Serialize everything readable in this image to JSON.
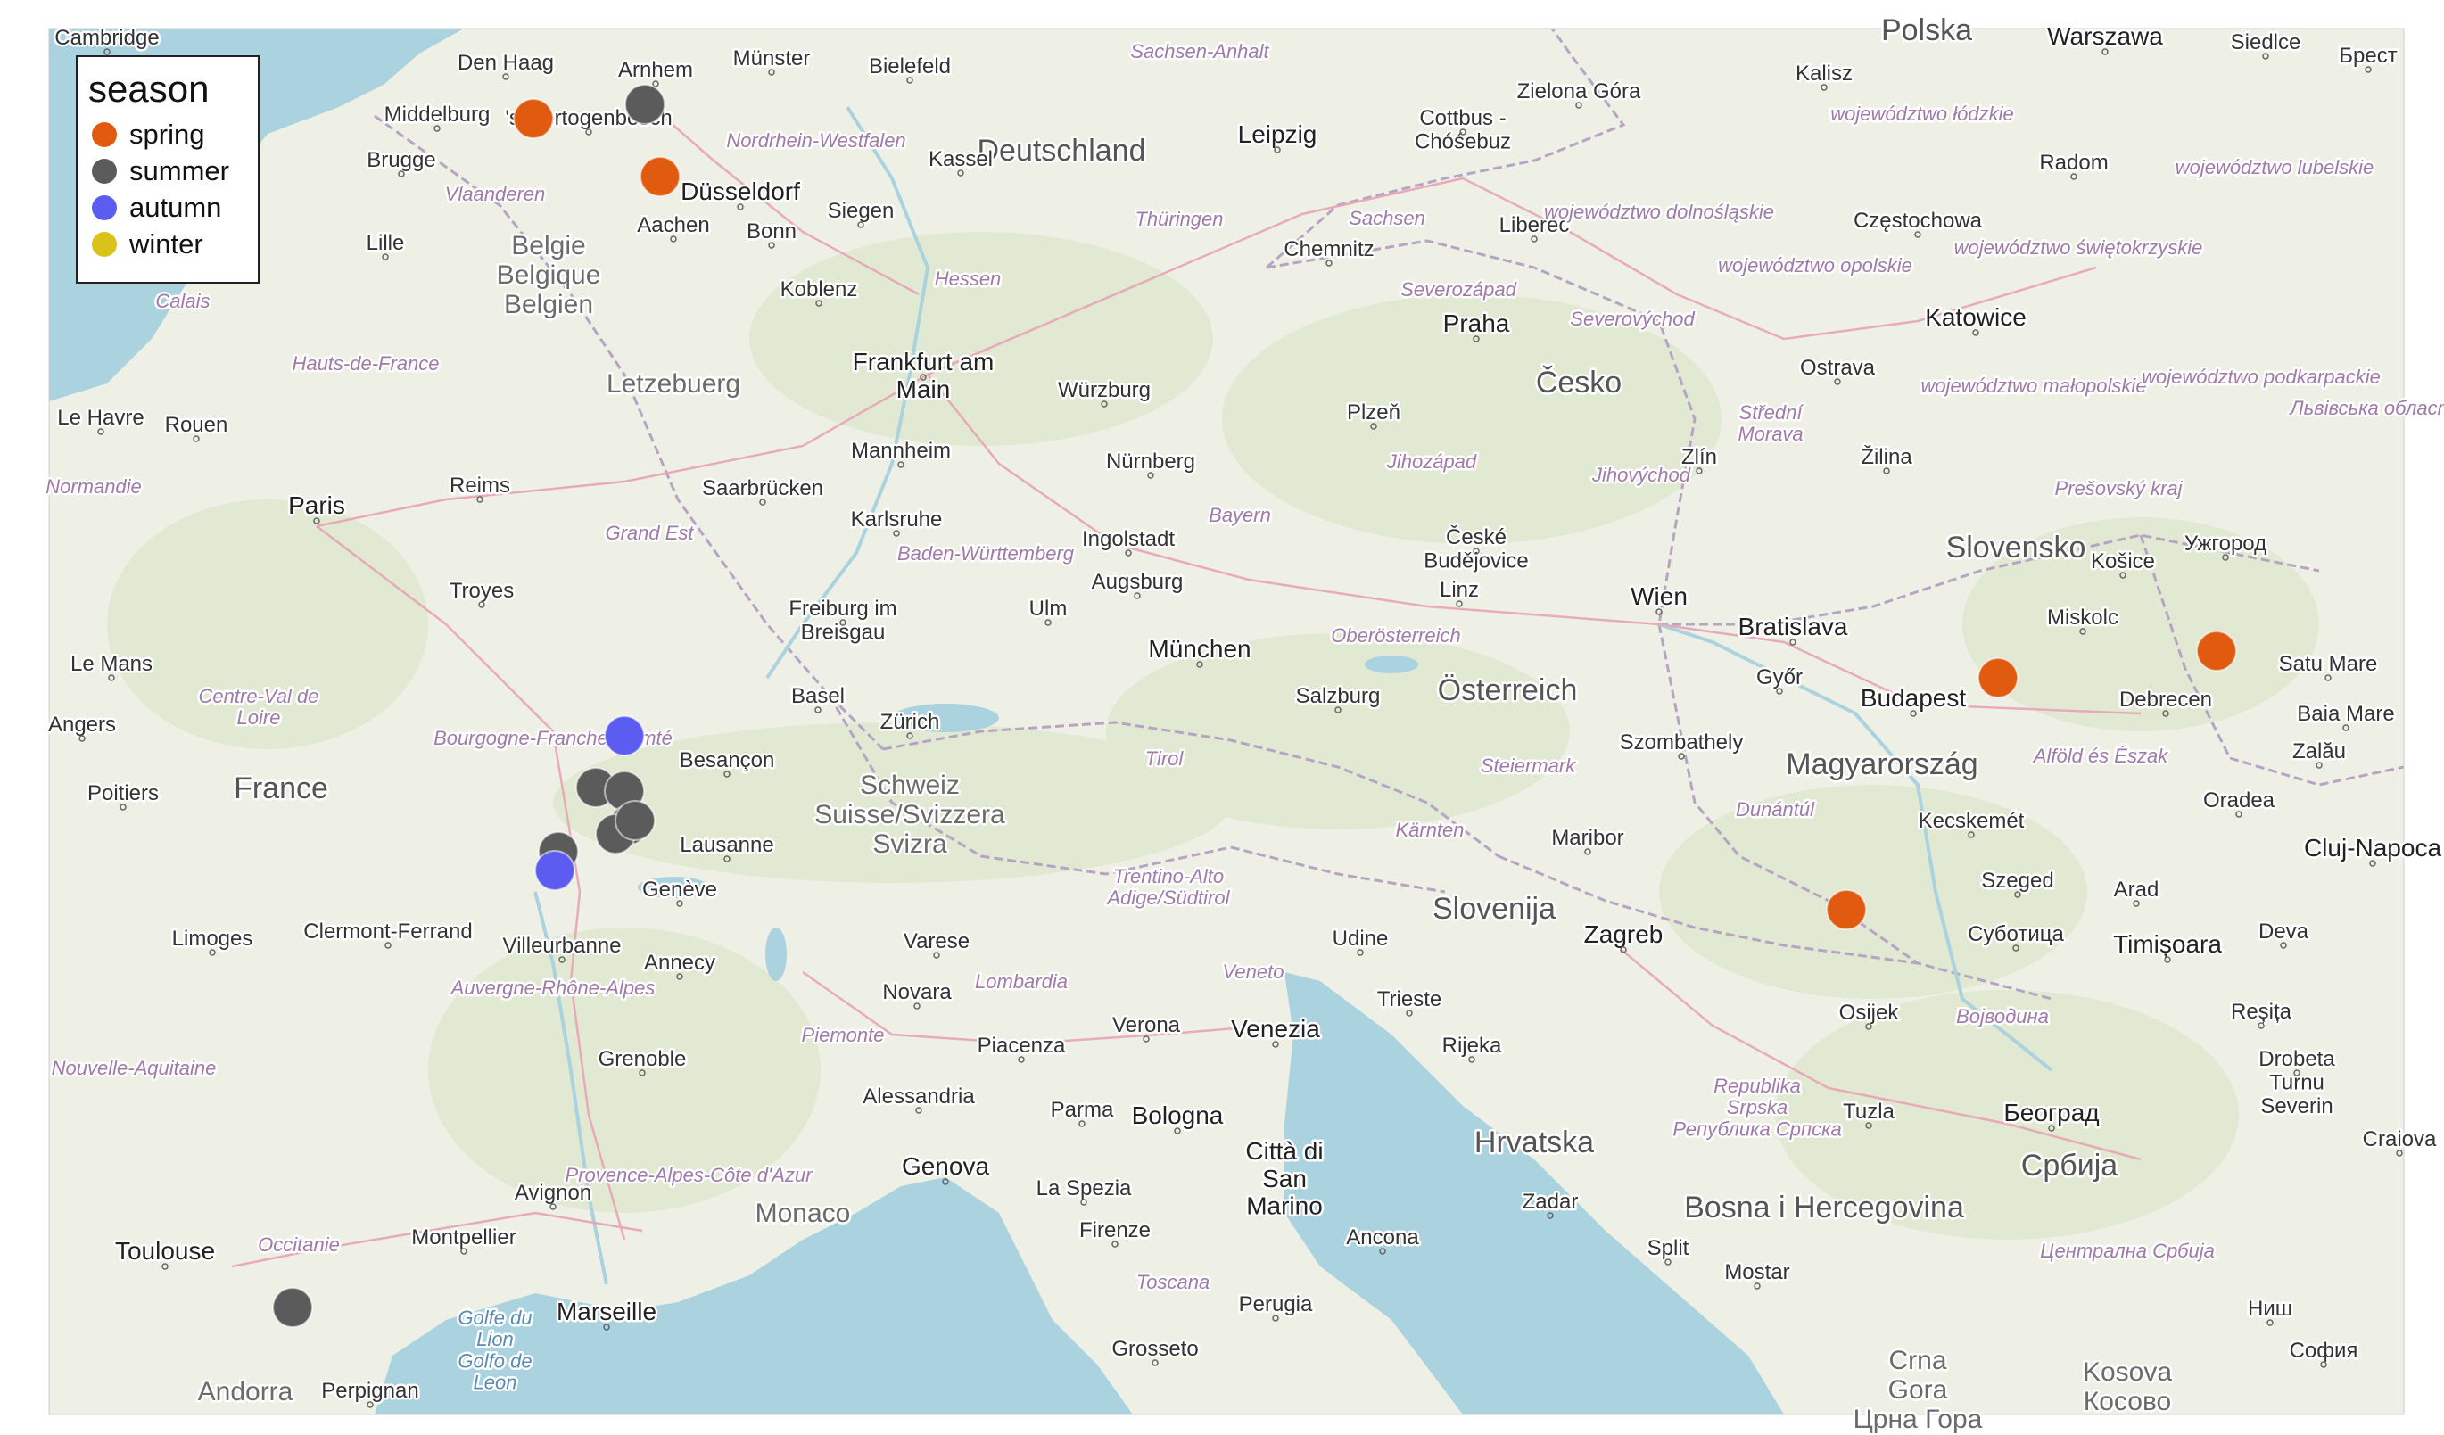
{
  "legend": {
    "title": "season",
    "entries": [
      {
        "label": "spring",
        "color": "#E05A10"
      },
      {
        "label": "summer",
        "color": "#5B5B5B"
      },
      {
        "label": "autumn",
        "color": "#5C5CF0"
      },
      {
        "label": "winter",
        "color": "#D9C21A"
      }
    ]
  },
  "map": {
    "style": "OpenStreetMap basemap",
    "countries": [
      "Deutschland",
      "Belgie / Belgique / Belgien",
      "Letzebuerg",
      "France",
      "Schweiz/ Suisse/Svizzera/ Svizra",
      "Österreich",
      "Česko",
      "Polska",
      "Slovensko",
      "Magyarország",
      "Slovenija",
      "Hrvatska",
      "Bosna i Hercegovina",
      "Србија",
      "Monaco",
      "Città di San Marino",
      "Andorra",
      "Kosova / Косово",
      "Crna Gora / Црна Гора"
    ],
    "cities": [
      "Cambridge",
      "Den Haag",
      "Arnhem",
      "Münster",
      "Bielefeld",
      "Middelburg",
      "'s-Hertogenbosch",
      "Brugge",
      "Kassel",
      "Düsseldorf",
      "Aachen",
      "Bonn",
      "Siegen",
      "Lille",
      "Koblenz",
      "Leipzig",
      "Cottbus - Chóśebuz",
      "Zielona Góra",
      "Kalisz",
      "Warszawa",
      "Siedlce",
      "Брест",
      "Radom",
      "Częstochowa",
      "Katowice",
      "Chemnitz",
      "Liberec",
      "Praha",
      "Plzeň",
      "Ostrava",
      "Zlín",
      "Žilina",
      "Frankfurt am Main",
      "Würzburg",
      "Mannheim",
      "Nürnberg",
      "Saarbrücken",
      "Karlsruhe",
      "Ingolstadt",
      "Augsburg",
      "Ulm",
      "München",
      "Freiburg im Breisgau",
      "Basel",
      "Zürich",
      "Besançon",
      "Lausanne",
      "Genève",
      "Annecy",
      "Villeurbanne",
      "Grenoble",
      "Varese",
      "Novara",
      "Piacenza",
      "Alessandria",
      "Genova",
      "Parma",
      "Bologna",
      "Verona",
      "Venezia",
      "Udine",
      "Trieste",
      "Rijeka",
      "Zagreb",
      "Maribor",
      "Szombathely",
      "Győr",
      "Bratislava",
      "Wien",
      "Linz",
      "Salzburg",
      "České Budějovice",
      "Budapest",
      "Miskolc",
      "Košice",
      "Ужгород",
      "Debrecen",
      "Satu Mare",
      "Baia Mare",
      "Zalău",
      "Oradea",
      "Cluj-Napoca",
      "Kecskemét",
      "Szeged",
      "Arad",
      "Timișoara",
      "Deva",
      "Суботица",
      "Osijek",
      "Tuzla",
      "Београд",
      "Reșița",
      "Drobeta Turnu Severin",
      "Craiova",
      "Ниш",
      "София",
      "Mostar",
      "Split",
      "Zadar",
      "Ancona",
      "Perugia",
      "Firenze",
      "La Spezia",
      "Grosseto",
      "Marseille",
      "Avignon",
      "Montpellier",
      "Toulouse",
      "Perpignan",
      "Limoges",
      "Clermont-Ferrand",
      "Poitiers",
      "Angers",
      "Le Mans",
      "Le Havre",
      "Rouen",
      "Paris",
      "Reims",
      "Troyes"
    ],
    "regions": [
      "Vlaanderen",
      "Nordrhein-Westfalen",
      "Sachsen-Anhalt",
      "Hessen",
      "Thüringen",
      "Sachsen",
      "Bayern",
      "Baden-Württemberg",
      "Grand Est",
      "Hauts-de-France",
      "Normandie",
      "Centre-Val de Loire",
      "Bourgogne-Franche-Comté",
      "Auvergne-Rhône-Alpes",
      "Nouvelle-Aquitaine",
      "Occitanie",
      "Provence-Alpes-Côte d'Azur",
      "Lombardia",
      "Piemonte",
      "Veneto",
      "Trentino-Alto Adige/Südtirol",
      "Tirol",
      "Oberösterreich",
      "Steiermark",
      "Kärnten",
      "Dunántúl",
      "Alföld és Észak",
      "Војводина",
      "Republika Srpska / Република Српска",
      "Централна Србија",
      "Severozápad",
      "Severovýchod",
      "Jihozápad",
      "Jihovýchod",
      "Střední Morava",
      "Toscana",
      "Prešovský kraj",
      "województwo łódzkie",
      "województwo lubelskie",
      "województwo dolnośląskie",
      "województwo opolskie",
      "województwo świętokrzyskie",
      "województwo małopolskie",
      "województwo podkarpackie",
      "Львівська область",
      "Calais"
    ],
    "seas": [
      "Golfe du Lion / Golfo de Leon"
    ]
  },
  "points": [
    {
      "season": "spring",
      "place": "near Middelburg"
    },
    {
      "season": "summer",
      "place": "near Arnhem"
    },
    {
      "season": "spring",
      "place": "near Düsseldorf"
    },
    {
      "season": "autumn",
      "place": "Bourgogne-Franche-Comté"
    },
    {
      "season": "summer",
      "place": "Jura"
    },
    {
      "season": "summer",
      "place": "Jura"
    },
    {
      "season": "summer",
      "place": "Jura"
    },
    {
      "season": "summer",
      "place": "Jura"
    },
    {
      "season": "summer",
      "place": "Jura"
    },
    {
      "season": "summer",
      "place": "near Lyon"
    },
    {
      "season": "autumn",
      "place": "near Lyon"
    },
    {
      "season": "summer",
      "place": "Occitanie"
    },
    {
      "season": "spring",
      "place": "northeast of Budapest"
    },
    {
      "season": "spring",
      "place": "near Satu Mare"
    },
    {
      "season": "spring",
      "place": "near Pécs"
    }
  ]
}
